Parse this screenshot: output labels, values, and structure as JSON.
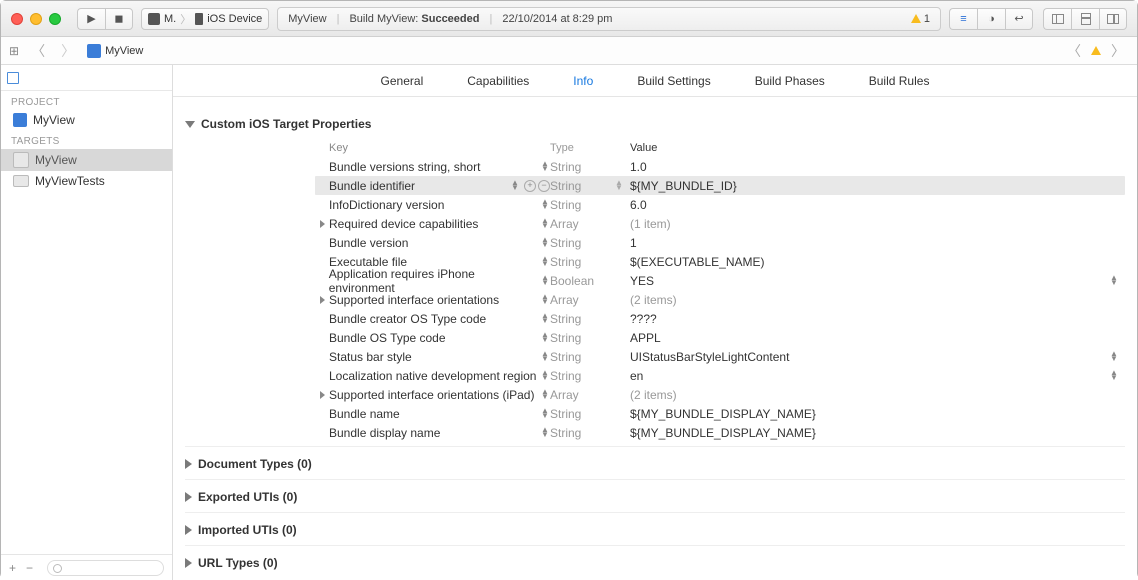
{
  "scheme": {
    "target": "M.",
    "device": "iOS Device"
  },
  "status": {
    "left": "MyView",
    "build_prefix": "Build MyView:",
    "build_result": "Succeeded",
    "timestamp": "22/10/2014 at 8:29 pm",
    "warn_count": "1"
  },
  "breadcrumb": {
    "name": "MyView"
  },
  "sidebar": {
    "project_label": "PROJECT",
    "targets_label": "TARGETS",
    "project": "MyView",
    "targets": [
      "MyView",
      "MyViewTests"
    ]
  },
  "tabs": [
    "General",
    "Capabilities",
    "Info",
    "Build Settings",
    "Build Phases",
    "Build Rules"
  ],
  "active_tab": "Info",
  "sections": {
    "custom": {
      "title": "Custom iOS Target Properties",
      "head": {
        "key": "Key",
        "type": "Type",
        "value": "Value"
      },
      "rows": [
        {
          "key": "Bundle versions string, short",
          "type": "String",
          "value": "1.0"
        },
        {
          "key": "Bundle identifier",
          "type": "String",
          "value": "${MY_BUNDLE_ID}",
          "selected": true,
          "typeStepper": true
        },
        {
          "key": "InfoDictionary version",
          "type": "String",
          "value": "6.0"
        },
        {
          "key": "Required device capabilities",
          "type": "Array",
          "value": "(1 item)",
          "expandable": true,
          "dim": true
        },
        {
          "key": "Bundle version",
          "type": "String",
          "value": "1"
        },
        {
          "key": "Executable file",
          "type": "String",
          "value": "$(EXECUTABLE_NAME)"
        },
        {
          "key": "Application requires iPhone environment",
          "type": "Boolean",
          "value": "YES",
          "endStepper": true
        },
        {
          "key": "Supported interface orientations",
          "type": "Array",
          "value": "(2 items)",
          "expandable": true,
          "dim": true
        },
        {
          "key": "Bundle creator OS Type code",
          "type": "String",
          "value": "????"
        },
        {
          "key": "Bundle OS Type code",
          "type": "String",
          "value": "APPL"
        },
        {
          "key": "Status bar style",
          "type": "String",
          "value": "UIStatusBarStyleLightContent",
          "endStepper": true
        },
        {
          "key": "Localization native development region",
          "type": "String",
          "value": "en",
          "endStepper": true
        },
        {
          "key": "Supported interface orientations (iPad)",
          "type": "Array",
          "value": "(2 items)",
          "expandable": true,
          "dim": true
        },
        {
          "key": "Bundle name",
          "type": "String",
          "value": "${MY_BUNDLE_DISPLAY_NAME}"
        },
        {
          "key": "Bundle display name",
          "type": "String",
          "value": "${MY_BUNDLE_DISPLAY_NAME}"
        }
      ]
    },
    "doc_types": "Document Types (0)",
    "exported": "Exported UTIs (0)",
    "imported": "Imported UTIs (0)",
    "url_types": "URL Types (0)"
  }
}
